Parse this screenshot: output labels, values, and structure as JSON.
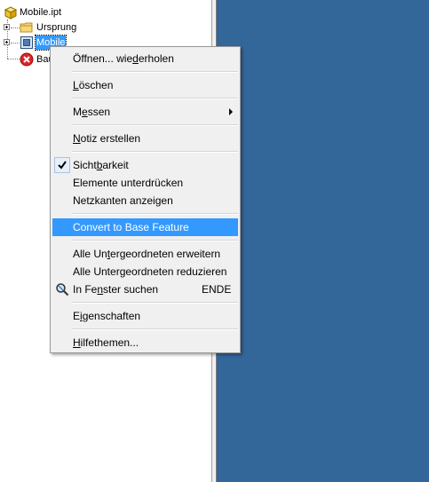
{
  "tree": {
    "root_label": "Mobile.ipt",
    "items": [
      {
        "label": "Ursprung"
      },
      {
        "label": "Mobile"
      },
      {
        "label": "Bau"
      }
    ]
  },
  "menu": {
    "items": [
      {
        "pre": "Öffnen... wie",
        "mn": "d",
        "post": "erholen"
      },
      {
        "pre": "",
        "mn": "L",
        "post": "öschen"
      },
      {
        "pre": "M",
        "mn": "e",
        "post": "ssen"
      },
      {
        "pre": "",
        "mn": "N",
        "post": "otiz erstellen"
      },
      {
        "pre": "Sicht",
        "mn": "b",
        "post": "arkeit"
      },
      {
        "pre": "Elemente unterdrücken",
        "mn": "",
        "post": ""
      },
      {
        "pre": "Netzkanten anzeigen",
        "mn": "",
        "post": ""
      },
      {
        "pre": "Convert to Base Feature",
        "mn": "",
        "post": ""
      },
      {
        "pre": "Alle Un",
        "mn": "t",
        "post": "ergeordneten erweitern"
      },
      {
        "pre": "Alle Unter",
        "mn": "g",
        "post": "eordneten reduzieren"
      },
      {
        "pre": "In Fe",
        "mn": "n",
        "post": "ster suchen",
        "shortcut": "ENDE"
      },
      {
        "pre": "E",
        "mn": "i",
        "post": "genschaften"
      },
      {
        "pre": "",
        "mn": "H",
        "post": "ilfethemen..."
      }
    ]
  },
  "colors": {
    "highlight": "#3399ff",
    "canvas": "#336699",
    "menu_bg": "#f0f0f0"
  },
  "icons": {
    "root": "part-cube-icon",
    "ursprung": "folder-icon",
    "mobile": "solid-body-icon",
    "bau": "error-circle-icon",
    "check": "checkmark-icon",
    "find": "magnifier-icon",
    "submenu": "submenu-arrow-icon"
  }
}
